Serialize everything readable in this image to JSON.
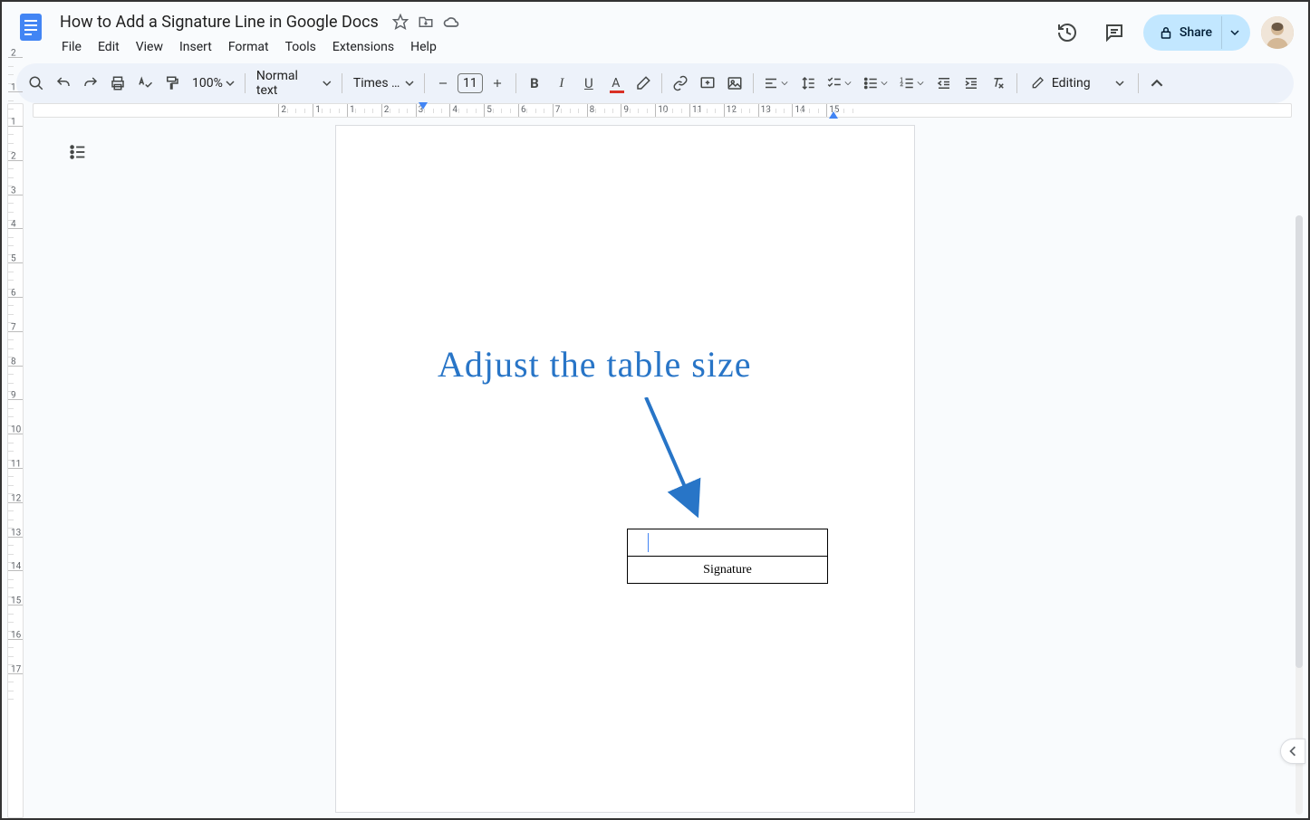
{
  "doc_title": "How to Add a Signature Line in Google Docs",
  "menus": [
    "File",
    "Edit",
    "View",
    "Insert",
    "Format",
    "Tools",
    "Extensions",
    "Help"
  ],
  "share_label": "Share",
  "toolbar": {
    "zoom": "100%",
    "style": "Normal text",
    "font": "Times …",
    "font_size": "11",
    "editing_mode": "Editing"
  },
  "ruler_h_numbers": [
    "2",
    "1",
    "1",
    "2",
    "3",
    "4",
    "5",
    "6",
    "7",
    "8",
    "9",
    "10",
    "11",
    "12",
    "13",
    "14",
    "15"
  ],
  "ruler_v_numbers": [
    "2",
    "1",
    "1",
    "2",
    "3",
    "4",
    "5",
    "6",
    "7",
    "8",
    "9",
    "10",
    "11",
    "12",
    "13",
    "14",
    "15",
    "16",
    "17"
  ],
  "annotation_text": "Adjust the table size",
  "signature_label": "Signature"
}
